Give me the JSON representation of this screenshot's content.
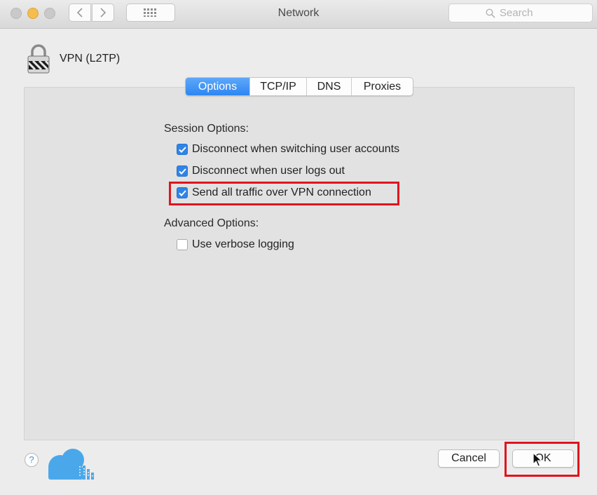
{
  "window": {
    "title": "Network",
    "search_placeholder": "Search"
  },
  "connection": {
    "name": "VPN (L2TP)"
  },
  "tabs": [
    {
      "label": "Options",
      "active": true
    },
    {
      "label": "TCP/IP",
      "active": false
    },
    {
      "label": "DNS",
      "active": false
    },
    {
      "label": "Proxies",
      "active": false
    }
  ],
  "session_options": {
    "heading": "Session Options:",
    "items": [
      {
        "label": "Disconnect when switching user accounts",
        "checked": true
      },
      {
        "label": "Disconnect when user logs out",
        "checked": true
      },
      {
        "label": "Send all traffic over VPN connection",
        "checked": true,
        "highlighted": true
      }
    ]
  },
  "advanced_options": {
    "heading": "Advanced Options:",
    "items": [
      {
        "label": "Use verbose logging",
        "checked": false
      }
    ]
  },
  "footer": {
    "help_label": "?",
    "cancel_label": "Cancel",
    "ok_label": "OK"
  },
  "colors": {
    "accent": "#2f84e8",
    "highlight": "#e0141e",
    "logo": "#4aa8ea"
  },
  "icons": {
    "vpn": "padlock-icon",
    "back": "chevron-left-icon",
    "forward": "chevron-right-icon",
    "grid": "grid-icon",
    "search": "search-icon",
    "help": "help-icon",
    "logo": "cloud-logo-icon",
    "cursor": "mouse-pointer-icon",
    "check": "checkmark-icon"
  }
}
